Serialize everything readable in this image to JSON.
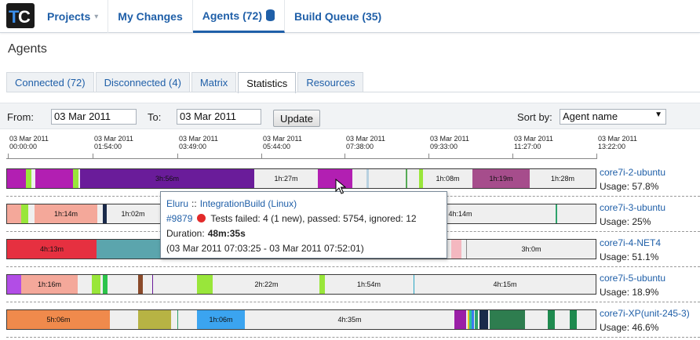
{
  "header": {
    "logo": "teamcity-logo-icon",
    "nav": [
      {
        "label": "Projects"
      },
      {
        "label": "My Changes"
      },
      {
        "label": "Agents (72)"
      },
      {
        "label": "Build Queue (35)"
      }
    ]
  },
  "page_title": "Agents",
  "tabs": [
    {
      "label": "Connected (72)"
    },
    {
      "label": "Disconnected (4)"
    },
    {
      "label": "Matrix"
    },
    {
      "label": "Statistics"
    },
    {
      "label": "Resources"
    }
  ],
  "filter": {
    "from_label": "From:",
    "from_value": "03 Mar 2011",
    "to_label": "To:",
    "to_value": "03 Mar 2011",
    "update_label": "Update",
    "sort_label": "Sort by:",
    "sort_value": "Agent name"
  },
  "timeline_ticks": [
    {
      "date": "03 Mar 2011",
      "time": "00:00:00"
    },
    {
      "date": "03 Mar 2011",
      "time": "01:54:00"
    },
    {
      "date": "03 Mar 2011",
      "time": "03:49:00"
    },
    {
      "date": "03 Mar 2011",
      "time": "05:44:00"
    },
    {
      "date": "03 Mar 2011",
      "time": "07:38:00"
    },
    {
      "date": "03 Mar 2011",
      "time": "09:33:00"
    },
    {
      "date": "03 Mar 2011",
      "time": "11:27:00"
    },
    {
      "date": "03 Mar 2011",
      "time": "13:22:00"
    }
  ],
  "agents": [
    {
      "name": "core7i-2-ubuntu",
      "usage": "Usage: 57.8%",
      "segments": [
        {
          "start": 0.0,
          "end": 0.032,
          "color": "#b21fb2",
          "label": ""
        },
        {
          "start": 0.032,
          "end": 0.041,
          "color": "#99e63a",
          "label": ""
        },
        {
          "start": 0.048,
          "end": 0.112,
          "color": "#b21fb2",
          "label": ""
        },
        {
          "start": 0.112,
          "end": 0.122,
          "color": "#99e63a",
          "label": ""
        },
        {
          "start": 0.124,
          "end": 0.42,
          "color": "#6a1c9a",
          "label": "3h:56m"
        },
        {
          "start": 0.42,
          "end": 0.528,
          "color": "#efefef",
          "label": "1h:27m"
        },
        {
          "start": 0.528,
          "end": 0.587,
          "color": "#b21fb2",
          "label": ""
        },
        {
          "start": 0.61,
          "end": 0.614,
          "color": "#b7d0e0",
          "label": ""
        },
        {
          "start": 0.677,
          "end": 0.679,
          "color": "#55aa55",
          "label": ""
        },
        {
          "start": 0.7,
          "end": 0.706,
          "color": "#99e63a",
          "label": ""
        },
        {
          "start": 0.706,
          "end": 0.79,
          "color": "#efefef",
          "label": "1h:08m"
        },
        {
          "start": 0.79,
          "end": 0.888,
          "color": "#a64d8c",
          "label": "1h:19m"
        },
        {
          "start": 0.888,
          "end": 1.0,
          "color": "#efefef",
          "label": "1h:28m"
        }
      ]
    },
    {
      "name": "core7i-3-ubuntu",
      "usage": "Usage: 25%",
      "segments": [
        {
          "start": 0.0,
          "end": 0.024,
          "color": "#f4a89a",
          "label": ""
        },
        {
          "start": 0.024,
          "end": 0.036,
          "color": "#99e63a",
          "label": ""
        },
        {
          "start": 0.046,
          "end": 0.152,
          "color": "#f4a89a",
          "label": "1h:14m"
        },
        {
          "start": 0.162,
          "end": 0.169,
          "color": "#1a2a4a",
          "label": ""
        },
        {
          "start": 0.169,
          "end": 0.258,
          "color": "#efefef",
          "label": "1h:02m"
        },
        {
          "start": 0.72,
          "end": 0.82,
          "color": "#efefef",
          "label": "4h:14m"
        },
        {
          "start": 0.932,
          "end": 0.935,
          "color": "#2ea36b",
          "label": ""
        }
      ]
    },
    {
      "name": "core7i-4-NET4",
      "usage": "Usage: 51.1%",
      "segments": [
        {
          "start": 0.0,
          "end": 0.152,
          "color": "#e63040",
          "label": "4h:13m"
        },
        {
          "start": 0.152,
          "end": 0.26,
          "color": "#5ba5ad",
          "label": ""
        },
        {
          "start": 0.755,
          "end": 0.772,
          "color": "#f4b8c0",
          "label": ""
        },
        {
          "start": 0.78,
          "end": 0.781,
          "color": "#888888",
          "label": ""
        },
        {
          "start": 0.781,
          "end": 1.0,
          "color": "#efefef",
          "label": "3h:0m"
        }
      ]
    },
    {
      "name": "core7i-5-ubuntu",
      "usage": "Usage: 18.9%",
      "segments": [
        {
          "start": 0.0,
          "end": 0.024,
          "color": "#b24de6",
          "label": ""
        },
        {
          "start": 0.024,
          "end": 0.12,
          "color": "#f4a89a",
          "label": "1h:16m"
        },
        {
          "start": 0.144,
          "end": 0.158,
          "color": "#99e63a",
          "label": ""
        },
        {
          "start": 0.162,
          "end": 0.17,
          "color": "#2bc44a",
          "label": ""
        },
        {
          "start": 0.222,
          "end": 0.23,
          "color": "#8a4a2a",
          "label": ""
        },
        {
          "start": 0.247,
          "end": 0.248,
          "color": "#6a1c9a",
          "label": ""
        },
        {
          "start": 0.323,
          "end": 0.35,
          "color": "#99e63a",
          "label": ""
        },
        {
          "start": 0.35,
          "end": 0.53,
          "color": "#efefef",
          "label": "2h:22m"
        },
        {
          "start": 0.53,
          "end": 0.54,
          "color": "#99e63a",
          "label": ""
        },
        {
          "start": 0.54,
          "end": 0.69,
          "color": "#efefef",
          "label": "1h:54m"
        },
        {
          "start": 0.69,
          "end": 0.692,
          "color": "#2aa6c4",
          "label": ""
        },
        {
          "start": 0.692,
          "end": 1.0,
          "color": "#efefef",
          "label": "4h:15m"
        }
      ]
    },
    {
      "name": "core7i-XP(unit-245-3)",
      "usage": "Usage: 46.6%",
      "segments": [
        {
          "start": 0.0,
          "end": 0.175,
          "color": "#f08a4c",
          "label": "5h:06m"
        },
        {
          "start": 0.223,
          "end": 0.279,
          "color": "#b7b344",
          "label": ""
        },
        {
          "start": 0.29,
          "end": 0.291,
          "color": "#2ea36b",
          "label": ""
        },
        {
          "start": 0.323,
          "end": 0.404,
          "color": "#3ba4f0",
          "label": "1h:06m"
        },
        {
          "start": 0.404,
          "end": 0.76,
          "color": "#efefef",
          "label": "4h:35m"
        },
        {
          "start": 0.76,
          "end": 0.78,
          "color": "#9a1fa6",
          "label": ""
        },
        {
          "start": 0.782,
          "end": 0.785,
          "color": "#e6c91f",
          "label": ""
        },
        {
          "start": 0.785,
          "end": 0.789,
          "color": "#2bc4a0",
          "label": ""
        },
        {
          "start": 0.789,
          "end": 0.793,
          "color": "#3b7bf0",
          "label": ""
        },
        {
          "start": 0.795,
          "end": 0.8,
          "color": "#2ea36b",
          "label": ""
        },
        {
          "start": 0.803,
          "end": 0.818,
          "color": "#1a2a4a",
          "label": ""
        },
        {
          "start": 0.82,
          "end": 0.88,
          "color": "#2e7d4f",
          "label": ""
        },
        {
          "start": 0.918,
          "end": 0.93,
          "color": "#1f8a4f",
          "label": ""
        },
        {
          "start": 0.956,
          "end": 0.968,
          "color": "#1f8a4f",
          "label": ""
        }
      ]
    }
  ],
  "tooltip": {
    "project": "Eluru",
    "sep": "::",
    "config": "IntegrationBuild (Linux)",
    "build_number": "#9879",
    "status": "Tests failed: 4 (1 new), passed: 5754, ignored: 12",
    "duration_label": "Duration:",
    "duration": "48m:35s",
    "range": "(03 Mar 2011 07:03:25 - 03 Mar 2011 07:52:01)"
  },
  "colors": {
    "link": "#1f5fa8",
    "failed": "#e22a2a"
  }
}
